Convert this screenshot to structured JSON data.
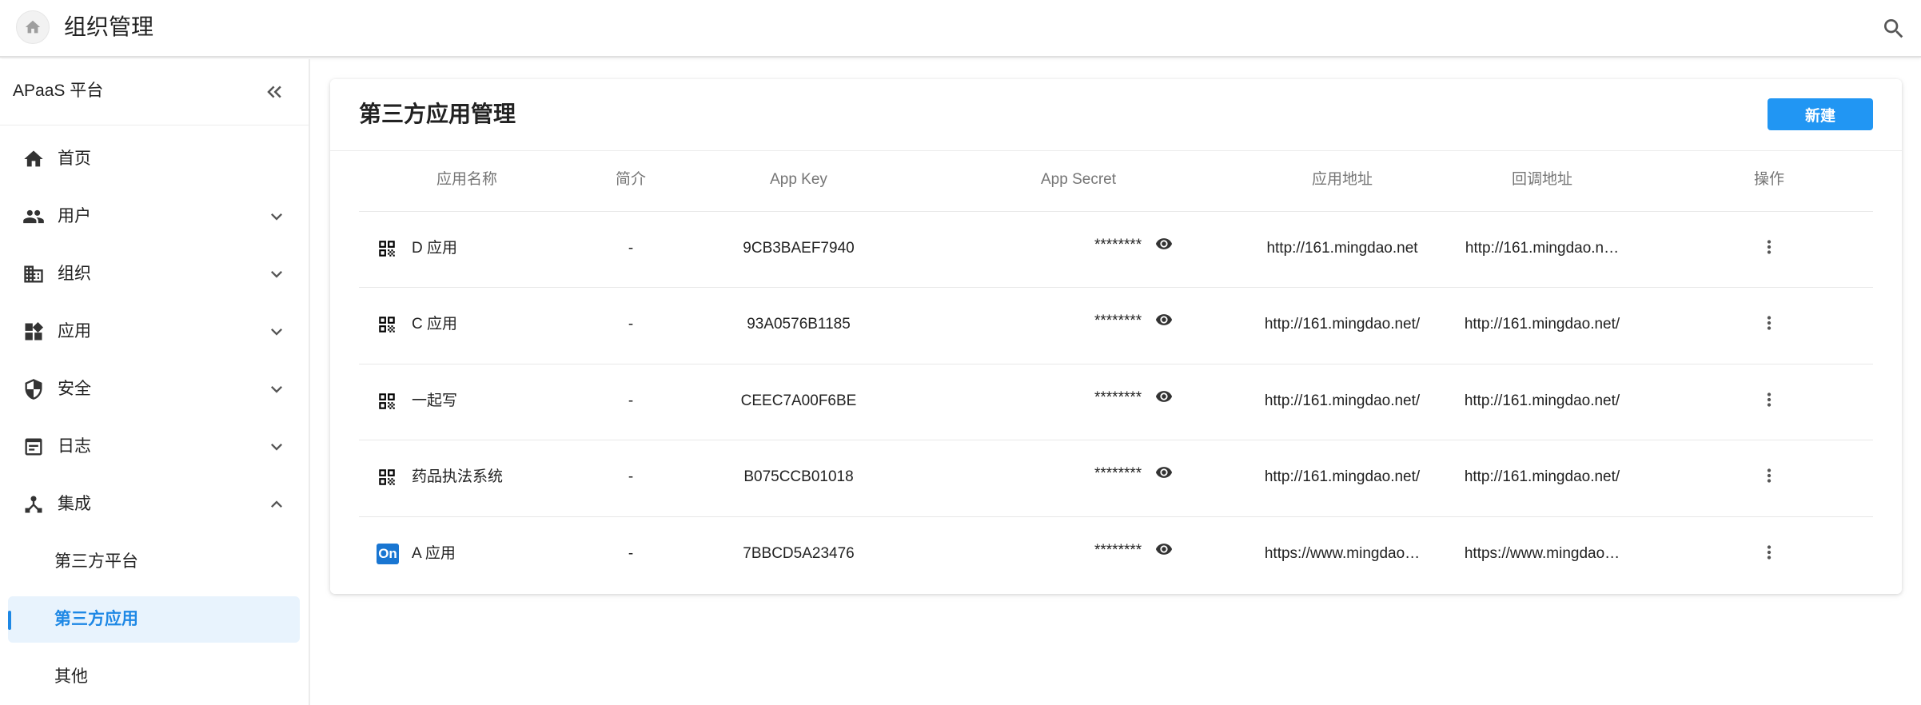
{
  "header": {
    "title": "组织管理"
  },
  "sidebar": {
    "brand": "APaaS 平台",
    "items": [
      {
        "label": "首页",
        "icon": "home-icon"
      },
      {
        "label": "用户",
        "icon": "people-icon"
      },
      {
        "label": "组织",
        "icon": "building-icon"
      },
      {
        "label": "应用",
        "icon": "widgets-icon"
      },
      {
        "label": "安全",
        "icon": "shield-icon"
      },
      {
        "label": "日志",
        "icon": "log-icon"
      },
      {
        "label": "集成",
        "icon": "integration-icon"
      }
    ],
    "sub_items": [
      {
        "label": "第三方平台"
      },
      {
        "label": "第三方应用",
        "active": true
      },
      {
        "label": "其他"
      }
    ]
  },
  "main": {
    "title": "第三方应用管理",
    "new_button": "新建",
    "columns": [
      "应用名称",
      "简介",
      "App Key",
      "App Secret",
      "应用地址",
      "回调地址",
      "操作"
    ],
    "rows": [
      {
        "name": "D 应用",
        "desc": "-",
        "app_key": "9CB3BAEF7940",
        "secret": "********",
        "url": "http://161.mingdao.net",
        "callback": "http://161.mingdao.n…",
        "icon": "qr-code-icon"
      },
      {
        "name": "C 应用",
        "desc": "-",
        "app_key": "93A0576B1185",
        "secret": "********",
        "url": "http://161.mingdao.net/",
        "callback": "http://161.mingdao.net/",
        "icon": "qr-code-icon"
      },
      {
        "name": "一起写",
        "desc": "-",
        "app_key": "CEEC7A00F6BE",
        "secret": "********",
        "url": "http://161.mingdao.net/",
        "callback": "http://161.mingdao.net/",
        "icon": "qr-code-icon"
      },
      {
        "name": "药品执法系统",
        "desc": "-",
        "app_key": "B075CCB01018",
        "secret": "********",
        "url": "http://161.mingdao.net/",
        "callback": "http://161.mingdao.net/",
        "icon": "qr-code-icon"
      },
      {
        "name": "A 应用",
        "desc": "-",
        "app_key": "7BBCD5A23476",
        "secret": "********",
        "url": "https://www.mingdao…",
        "callback": "https://www.mingdao…",
        "icon": "on-logo",
        "logo_text": "On"
      }
    ]
  },
  "colors": {
    "accent": "#2196f3",
    "active_bg": "#e8f3fd",
    "active_text": "#1e88e5"
  }
}
